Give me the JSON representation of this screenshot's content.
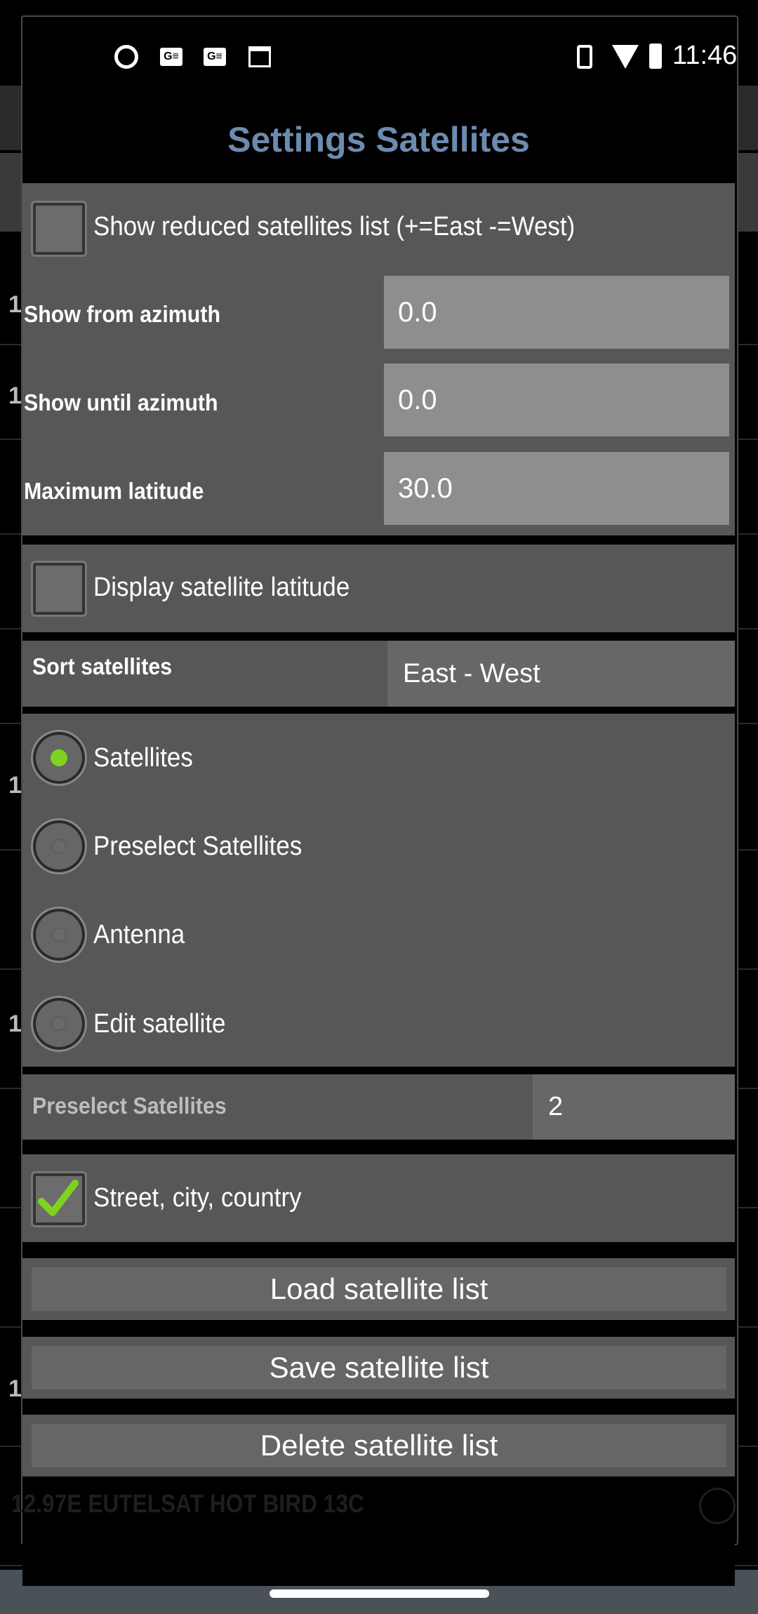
{
  "status_bar": {
    "time": "11:46",
    "left_icons": [
      "q-app-icon",
      "ge-news-icon",
      "ge-news-icon",
      "calendar-icon"
    ],
    "right_icons": [
      "vibrate-icon",
      "wifi-icon",
      "battery-charging-icon"
    ]
  },
  "dialog": {
    "title": "Settings Satellites",
    "title_color": "#6d8bb0",
    "reduced_list": {
      "label": "Show reduced satellites list (+=East -=West)",
      "checked": false
    },
    "fields": [
      {
        "label": "Show from azimuth",
        "value": "0.0"
      },
      {
        "label": "Show until azimuth",
        "value": "0.0"
      },
      {
        "label": "Maximum latitude",
        "value": "30.0"
      }
    ],
    "display_latitude": {
      "label": "Display satellite latitude",
      "checked": false
    },
    "sort": {
      "label": "Sort satellites",
      "value": "East - West"
    },
    "radios": [
      {
        "label": "Satellites",
        "selected": true
      },
      {
        "label": "Preselect Satellites",
        "selected": false
      },
      {
        "label": "Antenna",
        "selected": false
      },
      {
        "label": "Edit satellite",
        "selected": false
      }
    ],
    "preselect": {
      "label": "Preselect Satellites",
      "value": "2"
    },
    "street": {
      "label": "Street, city, country",
      "checked": true
    },
    "buttons": {
      "load": "Load satellite list",
      "save": "Save satellite list",
      "delete": "Delete satellite list"
    },
    "accent_color": "#7ed321"
  },
  "background": {
    "row_prefix": "1",
    "last_row": "12.97E EUTELSAT HOT BIRD 13C"
  }
}
